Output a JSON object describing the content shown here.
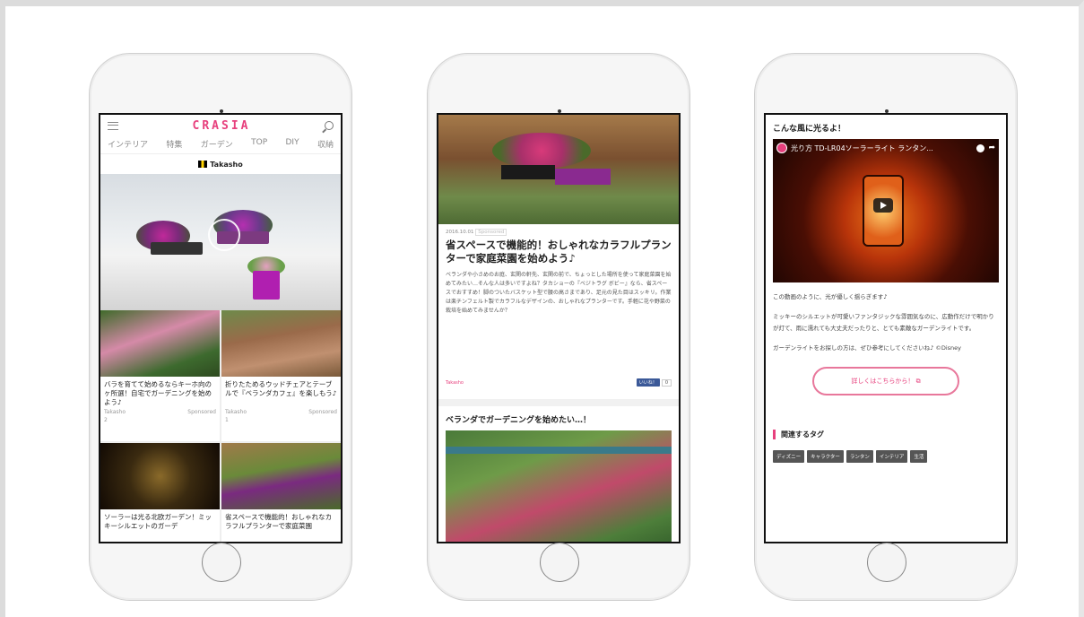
{
  "phone1": {
    "logo": "CRASIA",
    "nav": [
      "インテリア",
      "特集",
      "ガーデン",
      "TOP",
      "DIY",
      "収納"
    ],
    "sponsor": "Takasho",
    "cards": [
      {
        "title": "バラを育てて始めるならキーホ向のヶ所選！自宅でガーデニングを始めよう♪",
        "author": "Takasho",
        "likes": "2",
        "tag": "Sponsored"
      },
      {
        "title": "折りたためるウッドチェアとテーブルで『ベランダカフェ』を楽しもう♪",
        "author": "Takasho",
        "likes": "1",
        "tag": "Sponsored"
      },
      {
        "title": "ソーラーは光る北欧ガーデン！ミッキーシルエットのガーデ",
        "author": "",
        "likes": "",
        "tag": ""
      },
      {
        "title": "省スペースで機能的！おしゃれなカラフルプランターで家庭菜園",
        "author": "",
        "likes": "",
        "tag": ""
      }
    ]
  },
  "phone2": {
    "date": "2016.10.01",
    "sponsored": "Sponsored",
    "title": "省スペースで機能的！おしゃれなカラフルプランターで家庭菜園を始めよう♪",
    "body": "ベランダや小さめのお庭、玄関の軒先、玄関の前で、ちょっとした場所を使って家庭菜園を始めてみたい…そんな人は多いですよね？タカショーの『ベジトラグ ボビー』なら、省スペースでおすすめ！脚のついたバスケット型で腰の高さまであり、足元の見た目はスッキリ。作業は楽チンフェルト製でカラフルなデザインの、おしゃれなプランターです。手軽に花や野菜の栽培を始めてみませんか？",
    "author": "Takasho",
    "share_label": "いいね！",
    "share_count": "0",
    "subheading": "ベランダでガーデニングを始めたい…！"
  },
  "phone3": {
    "heading": "こんな風に光るよ！",
    "video_title": "光り方 TD-LR04ソーラーライト ランタン...",
    "para1": "この動画のように、光が優しく揺らぎます♪",
    "para2": "ミッキーのシルエットが可愛いファンタジックな雰囲気なのに、広動作だけで明かりが灯て、雨に濡れても大丈夫だったりと、とても素敵なガーデンライトです。",
    "para3": "ガーデンライトをお探しの方は、ぜひ参考にしてくださいね♪ ©Disney",
    "button": "詳しくはこちらから！",
    "tags_heading": "関連するタグ",
    "tags": [
      "ディズニー",
      "キャラクター",
      "ランタン",
      "インテリア",
      "生活"
    ]
  },
  "colors": {
    "brand": "#e7407d",
    "facebook": "#3b5998"
  }
}
